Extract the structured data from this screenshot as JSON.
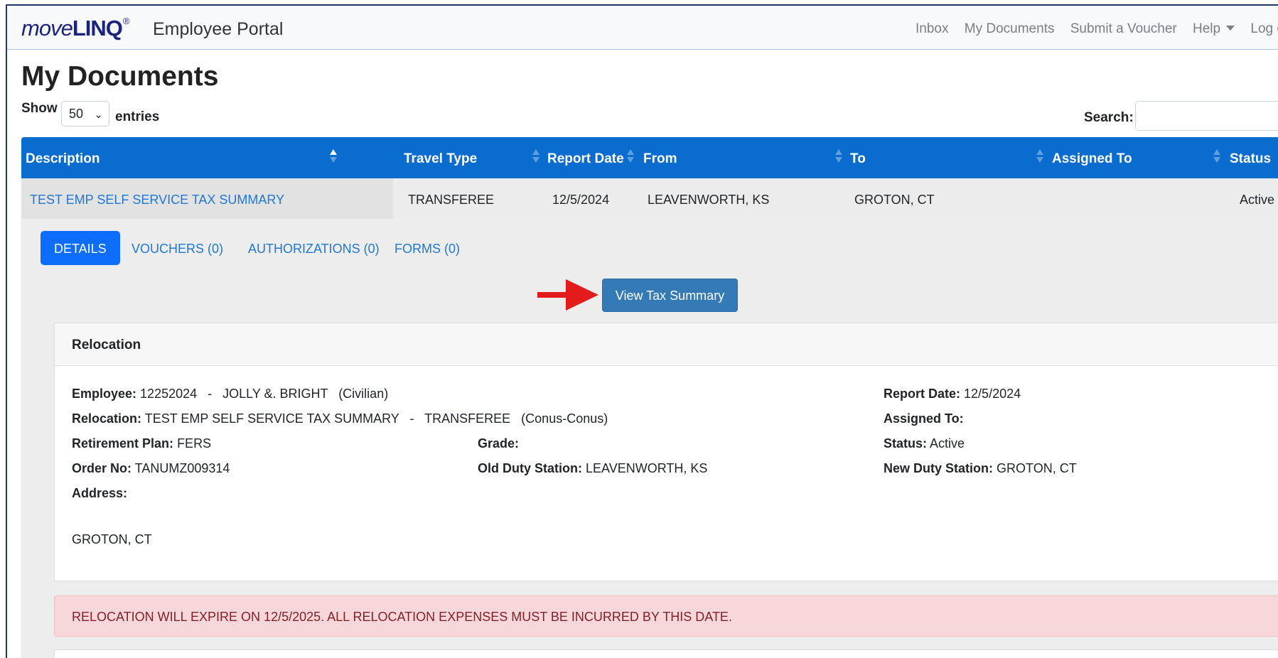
{
  "navbar": {
    "brand_move": "move",
    "brand_linq": "LINQ",
    "brand_reg": "®",
    "portal_title": "Employee Portal",
    "links": [
      "Inbox",
      "My Documents",
      "Submit a Voucher",
      "Help",
      "Log o"
    ]
  },
  "page": {
    "title": "My Documents",
    "show_label": "Show",
    "entries_value": "50",
    "entries_label": "entries",
    "search_label": "Search:",
    "search_value": ""
  },
  "table": {
    "headers": [
      "Description",
      "Travel Type",
      "Report Date",
      "From",
      "To",
      "Assigned To",
      "Status"
    ],
    "row": {
      "description": "TEST EMP SELF SERVICE TAX SUMMARY",
      "travel_type": "TRANSFEREE",
      "report_date": "12/5/2024",
      "from": "LEAVENWORTH, KS",
      "to": "GROTON, CT",
      "assigned_to": "",
      "status": "Active"
    }
  },
  "detail_tabs": [
    "DETAILS",
    "VOUCHERS (0)",
    "AUTHORIZATIONS (0)",
    "FORMS (0)"
  ],
  "view_tax_button": "View Tax Summary",
  "relocation": {
    "header": "Relocation",
    "employee_label": "Employee:",
    "employee_value": "12252024   -   JOLLY &. BRIGHT   (Civilian)",
    "relocation_label": "Relocation:",
    "relocation_value": "TEST EMP SELF SERVICE TAX SUMMARY   -   TRANSFEREE   (Conus-Conus)",
    "retirement_label": "Retirement Plan:",
    "retirement_value": "FERS",
    "order_label": "Order No:",
    "order_value": "TANUMZ009314",
    "address_label": "Address:",
    "address_value": "GROTON, CT",
    "grade_label": "Grade:",
    "grade_value": "",
    "old_duty_label": "Old Duty Station:",
    "old_duty_value": "LEAVENWORTH, KS",
    "report_date_label": "Report Date:",
    "report_date_value": "12/5/2024",
    "assigned_label": "Assigned To:",
    "assigned_value": "",
    "status_label": "Status:",
    "status_value": "Active",
    "new_duty_label": "New Duty Station:",
    "new_duty_value": "GROTON, CT"
  },
  "alert": "RELOCATION WILL EXPIRE ON 12/5/2025. ALL RELOCATION EXPENSES MUST BE INCURRED BY THIS DATE.",
  "colors": {
    "header_blue": "#0a6cce",
    "link_blue": "#1f77d6",
    "button_blue": "#337ab7",
    "alert_bg": "#f8d7da",
    "alert_text": "#842029",
    "arrow_red": "#e31b1b"
  }
}
